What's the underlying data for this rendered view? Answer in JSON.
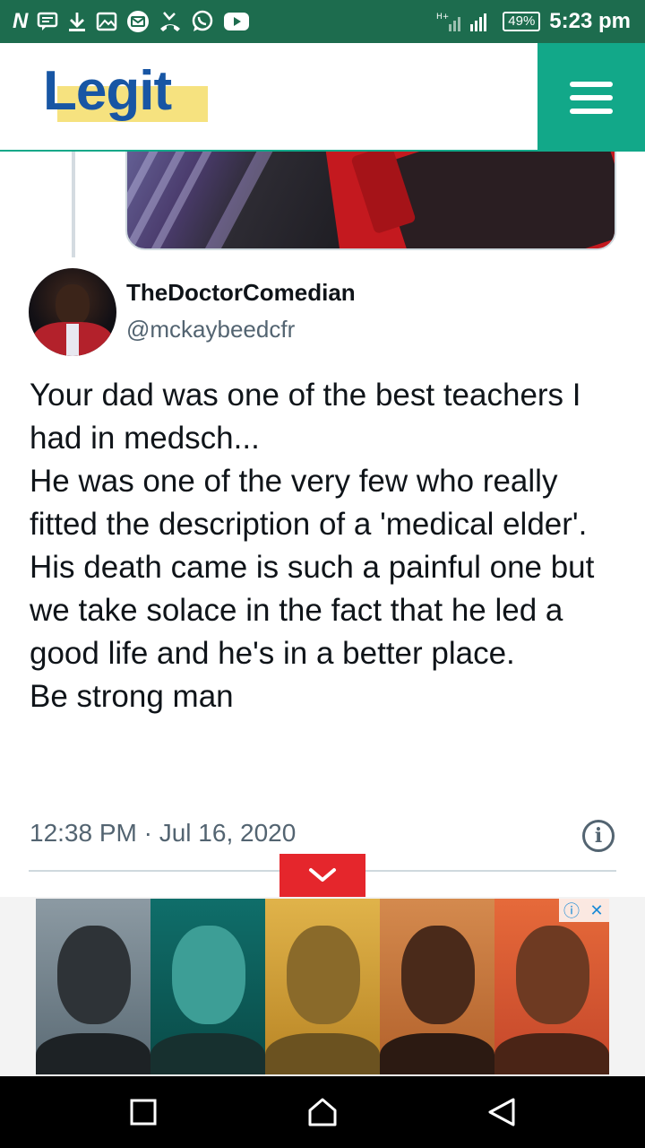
{
  "status_bar": {
    "icons": [
      "n-badge-icon",
      "message-icon",
      "download-icon",
      "image-icon",
      "mail-icon",
      "missed-call-icon",
      "whatsapp-icon",
      "youtube-icon"
    ],
    "network": "signal-icon",
    "battery": "49%",
    "time": "5:23 pm"
  },
  "header": {
    "logo_text": "Legit",
    "logo_color": "#1856a4",
    "logo_highlight": "#f6e27f",
    "accent": "#12a889",
    "menu_icon": "hamburger-icon"
  },
  "tweet": {
    "author_name": "TheDoctorComedian",
    "author_handle": "@mckaybeedcfr",
    "lines": [
      "Your dad was one of the best teachers I had in medsch...",
      "He was one of the very few who really fitted the description of a 'medical elder'.",
      "His death came is such a painful one but we take solace in the fact that he led a good life and he's in a better place.",
      "Be strong man"
    ],
    "timestamp": "12:38 PM · Jul 16, 2020",
    "info_icon": "i"
  },
  "ad": {
    "choices_info": "ⓘ",
    "choices_close": "✕"
  },
  "nav_bar": {
    "buttons": [
      "recents-square-icon",
      "home-icon",
      "back-triangle-icon"
    ]
  }
}
